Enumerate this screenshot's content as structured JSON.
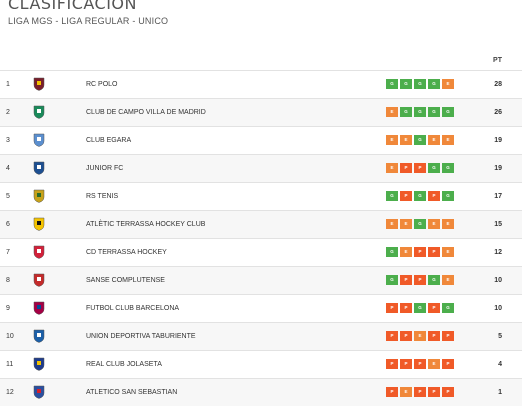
{
  "header": {
    "title": "CLASIFICACIÓN",
    "subtitle": "LIGA MGS - LIGA REGULAR - UNICO",
    "points_col": "PT"
  },
  "colors": {
    "G": "#4cae4c",
    "E": "#f0883a",
    "P": "#f05a28"
  },
  "rows": [
    {
      "pos": "1",
      "name": "RC POLO",
      "form": [
        "G",
        "G",
        "G",
        "G",
        "E"
      ],
      "pts": "28",
      "icon": "rc-polo-crest-icon"
    },
    {
      "pos": "2",
      "name": "CLUB DE CAMPO VILLA DE MADRID",
      "form": [
        "E",
        "G",
        "G",
        "G",
        "G"
      ],
      "pts": "26",
      "icon": "club-de-campo-crest-icon"
    },
    {
      "pos": "3",
      "name": "CLUB EGARA",
      "form": [
        "E",
        "E",
        "G",
        "E",
        "E"
      ],
      "pts": "19",
      "icon": "club-egara-crest-icon"
    },
    {
      "pos": "4",
      "name": "JUNIOR FC",
      "form": [
        "E",
        "P",
        "P",
        "G",
        "G"
      ],
      "pts": "19",
      "icon": "junior-fc-crest-icon"
    },
    {
      "pos": "5",
      "name": "RS TENIS",
      "form": [
        "G",
        "P",
        "G",
        "P",
        "G"
      ],
      "pts": "17",
      "icon": "rs-tenis-crest-icon"
    },
    {
      "pos": "6",
      "name": "ATLÈTIC TERRASSA HOCKEY CLUB",
      "form": [
        "E",
        "E",
        "G",
        "E",
        "E"
      ],
      "pts": "15",
      "icon": "atletic-terrassa-crest-icon"
    },
    {
      "pos": "7",
      "name": "CD TERRASSA HOCKEY",
      "form": [
        "G",
        "E",
        "P",
        "P",
        "E"
      ],
      "pts": "12",
      "icon": "cd-terrassa-crest-icon"
    },
    {
      "pos": "8",
      "name": "SANSE COMPLUTENSE",
      "form": [
        "G",
        "P",
        "P",
        "G",
        "E"
      ],
      "pts": "10",
      "icon": "sanse-complutense-crest-icon"
    },
    {
      "pos": "9",
      "name": "FUTBOL CLUB BARCELONA",
      "form": [
        "P",
        "P",
        "G",
        "P",
        "G"
      ],
      "pts": "10",
      "icon": "fc-barcelona-crest-icon"
    },
    {
      "pos": "10",
      "name": "UNION DEPORTIVA TABURIENTE",
      "form": [
        "P",
        "P",
        "E",
        "P",
        "P"
      ],
      "pts": "5",
      "icon": "ud-taburiente-crest-icon"
    },
    {
      "pos": "11",
      "name": "REAL CLUB JOLASETA",
      "form": [
        "P",
        "P",
        "P",
        "E",
        "P"
      ],
      "pts": "4",
      "icon": "real-club-jolaseta-crest-icon"
    },
    {
      "pos": "12",
      "name": "ATLETICO SAN SEBASTIAN",
      "form": [
        "P",
        "E",
        "P",
        "P",
        "P"
      ],
      "pts": "1",
      "icon": "atletico-san-sebastian-crest-icon"
    }
  ]
}
